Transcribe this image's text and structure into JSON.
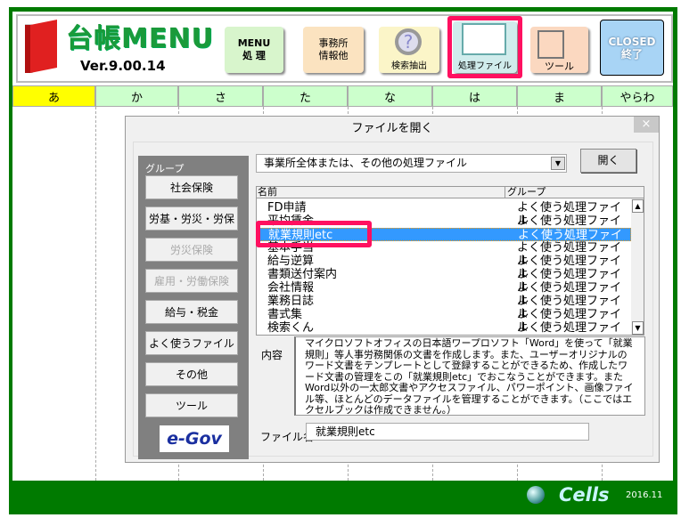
{
  "header": {
    "logo_title": "台帳MENU",
    "version": "Ver.9.00.14",
    "buttons": [
      {
        "label": "MENU\n処 理",
        "icon": "menu-icon",
        "color": "#d8f5cc"
      },
      {
        "label": "事務所\n情報他",
        "icon": "office-icon",
        "color": "#fbe3c0"
      },
      {
        "label": "検索抽出",
        "icon": "magnifier-question-icon",
        "color": "#fbf5c8"
      },
      {
        "label": "処理ファイル",
        "icon": "file-binder-icon",
        "color": "#d0ecec"
      },
      {
        "label": "ツール",
        "icon": "tool-icon",
        "color": "#fbd8c0"
      },
      {
        "label": "CLOSED\n終了",
        "icon": "closed-exit-icon",
        "color": "#a8d4f5"
      }
    ]
  },
  "tabs": [
    {
      "label": "あ",
      "active": true
    },
    {
      "label": "か"
    },
    {
      "label": "さ"
    },
    {
      "label": "た"
    },
    {
      "label": "な"
    },
    {
      "label": "は"
    },
    {
      "label": "ま"
    },
    {
      "label": "やらわ"
    }
  ],
  "dialog": {
    "title": "ファイルを開く",
    "close": "×",
    "group_label": "グループ",
    "groups": [
      {
        "label": "社会保険"
      },
      {
        "label": "労基・労災・労保"
      },
      {
        "label": "労災保険",
        "disabled": true
      },
      {
        "label": "雇用・労働保険",
        "disabled": true
      },
      {
        "label": "給与・税金"
      },
      {
        "label": "よく使うファイル"
      },
      {
        "label": "その他"
      },
      {
        "label": "ツール"
      }
    ],
    "egov": "e-Gov",
    "combo_value": "事業所全体または、その他の処理ファイル",
    "open_label": "開く",
    "list_headers": {
      "name": "名前",
      "group": "グループ"
    },
    "rows": [
      {
        "name": "FD申請",
        "group": "よく使う処理ファイル"
      },
      {
        "name": "平均賃金",
        "group": "よく使う処理ファイル"
      },
      {
        "name": "就業規則etc",
        "group": "よく使う処理ファイル",
        "selected": true
      },
      {
        "name": "基本手当",
        "group": "よく使う処理ファイル"
      },
      {
        "name": "給与逆算",
        "group": "よく使う処理ファイル"
      },
      {
        "name": "書類送付案内",
        "group": "よく使う処理ファイル"
      },
      {
        "name": "会社情報",
        "group": "よく使う処理ファイル"
      },
      {
        "name": "業務日誌",
        "group": "よく使う処理ファイル"
      },
      {
        "name": "書式集",
        "group": "よく使う処理ファイル"
      },
      {
        "name": "検索くん",
        "group": "よく使う処理ファイル"
      }
    ],
    "content_label": "内容",
    "content": "マイクロソフトオフィスの日本語ワープロソフト「Word」を使って「就業規則」等人事労務関係の文書を作成します。また、ユーザーオリジナルのワード文書をテンプレートとして登録することができるため、作成したワード文書の管理をこの「就業規則etc」でおこなうことができます。またWord以外の一太郎文書やアクセスファイル、パワーポイント、画像ファイル等、ほとんどのデータファイルを管理することができます。（ここではエクセルブックは作成できません。）",
    "filename_label": "ファイル名",
    "filename": "就業規則etc"
  },
  "footer": {
    "brand": "Cells",
    "date": "2016.11"
  },
  "colors": {
    "frame": "#007a00",
    "highlight": "#ff1060",
    "selection": "#3399ff",
    "tab_active": "#ffff00",
    "tab": "#ccffcc"
  }
}
